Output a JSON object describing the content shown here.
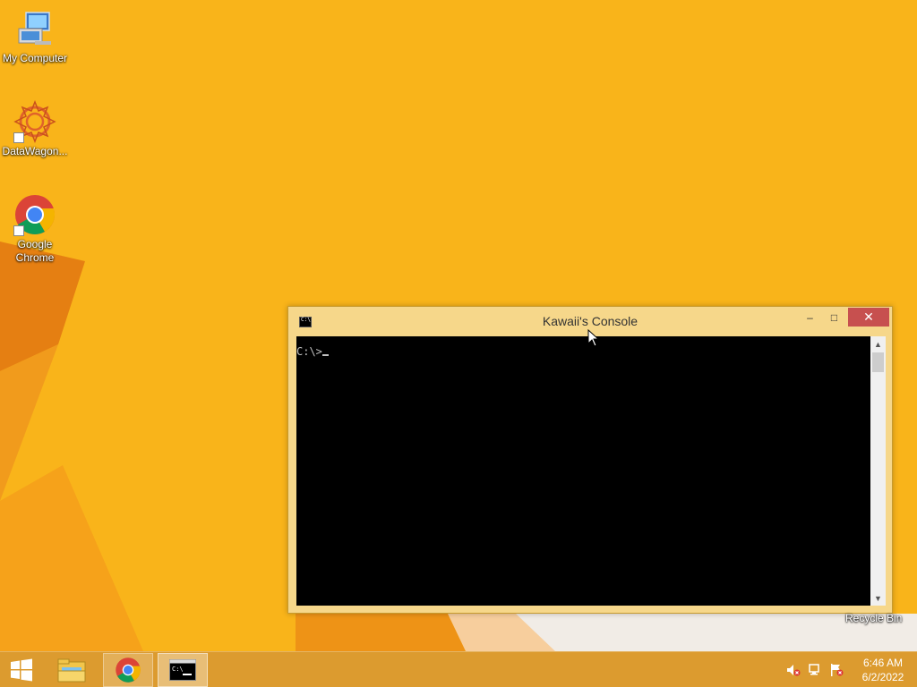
{
  "desktop": {
    "icons": [
      {
        "label": "My Computer",
        "icon": "computer-icon"
      },
      {
        "label": "DataWagon...",
        "icon": "datawagon-icon",
        "shortcut": true
      },
      {
        "label": "Google\nChrome",
        "icon": "chrome-icon",
        "shortcut": true
      }
    ],
    "recycle_bin_label": "Recycle Bin"
  },
  "console": {
    "title": "Kawaii's Console",
    "prompt": "C:\\>",
    "minimize_glyph": "–",
    "maximize_glyph": "□",
    "close_glyph": "✕",
    "scroll_up_glyph": "▲",
    "scroll_down_glyph": "▼"
  },
  "taskbar": {
    "buttons": [
      "start-button",
      "file-explorer-button",
      "google-chrome-button",
      "console-button"
    ],
    "clock_time": "6:46 AM",
    "clock_date": "6/2/2022"
  },
  "colors": {
    "wallpaper": "#f9b41a",
    "window_frame": "#f6d78a",
    "close_button": "#c7504f",
    "console_bg": "#000000"
  }
}
